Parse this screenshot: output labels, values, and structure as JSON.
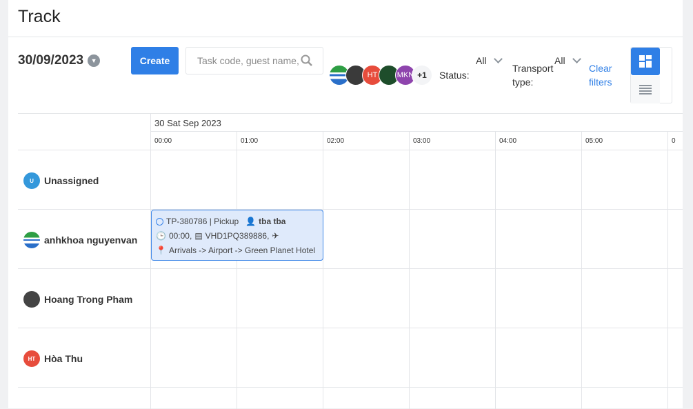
{
  "page": {
    "title": "Track"
  },
  "toolbar": {
    "date": "30/09/2023",
    "create_label": "Create",
    "search_placeholder": "Task code, guest name,",
    "avatars": [
      {
        "initials": "",
        "color": "#2e9e44"
      },
      {
        "initials": "",
        "color": "#444"
      },
      {
        "initials": "HT",
        "color": "#e74c3c"
      },
      {
        "initials": "",
        "color": "#1e4d2b"
      },
      {
        "initials": "MKN",
        "color": "#8e44ad"
      }
    ],
    "avatars_more": "+1",
    "status_label": "Status:",
    "status_value": "All",
    "transport_label": "Transport type:",
    "transport_value": "All",
    "clear_filters": "Clear filters",
    "accent": "#2f7fe6"
  },
  "timeline": {
    "date_header": "30 Sat Sep 2023",
    "hours": [
      "00:00",
      "01:00",
      "02:00",
      "03:00",
      "04:00",
      "05:00",
      "0"
    ],
    "rows": [
      {
        "name": "Unassigned",
        "initials": "U",
        "color": "#3498db"
      },
      {
        "name": "anhkhoa nguyenvan",
        "initials": "",
        "color": "#2e9e44"
      },
      {
        "name": "Hoang Trong Pham",
        "initials": "",
        "color": "#555"
      },
      {
        "name": "Hòa Thu",
        "initials": "HT",
        "color": "#e74c3c"
      }
    ]
  },
  "task": {
    "code": "TP-380786 | Pickup",
    "guest": "tba tba",
    "time": "00:00,",
    "flight": "VHD1PQ389886,",
    "route": "Arrivals -> Airport -> Green Planet Hotel"
  }
}
